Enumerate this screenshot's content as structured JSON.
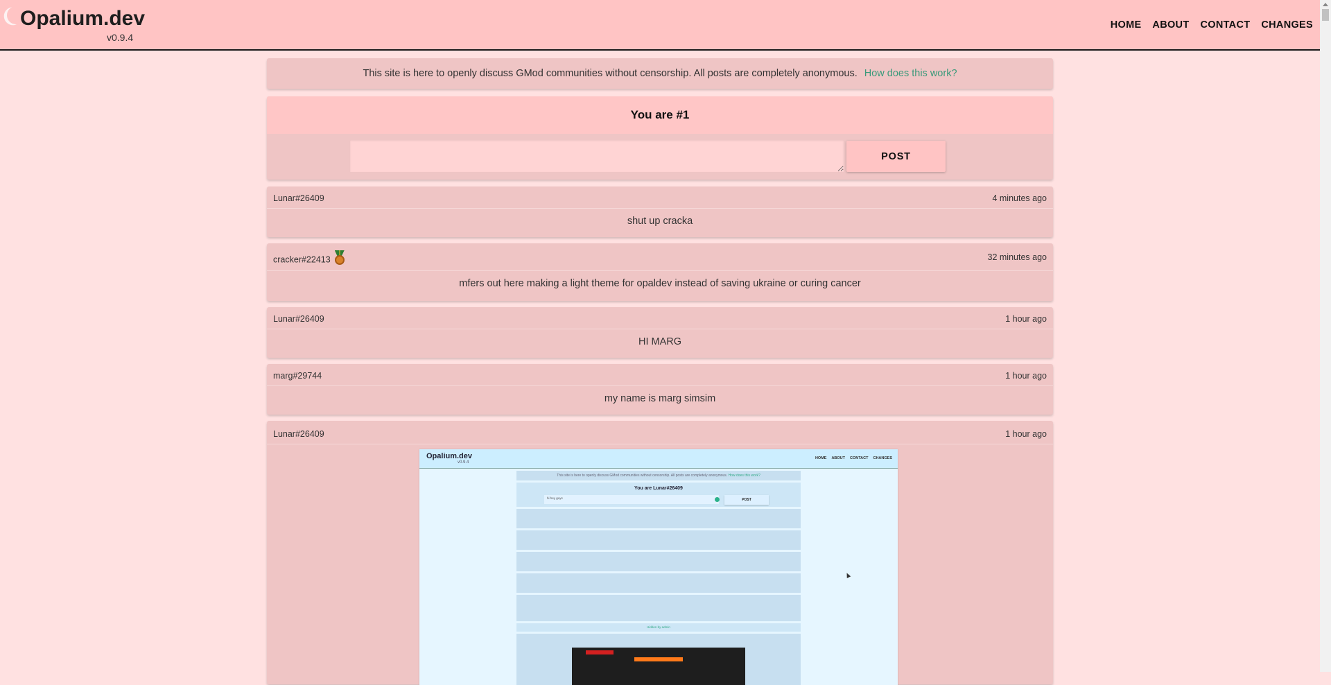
{
  "header": {
    "title": "Opalium.dev",
    "version": "v0.9.4",
    "nav": [
      "HOME",
      "ABOUT",
      "CONTACT",
      "CHANGES"
    ]
  },
  "notice": {
    "text": "This site is here to openly discuss GMod communities without censorship. All posts are completely anonymous.",
    "link": "How does this work?"
  },
  "composer": {
    "heading": "You are #1",
    "textarea_value": "",
    "post_label": "POST"
  },
  "posts": [
    {
      "author": "Lunar#26409",
      "time": "4 minutes ago",
      "body": "shut up cracka"
    },
    {
      "author": "cracker#22413",
      "time": "32 minutes ago",
      "body": "mfers out here making a light theme for opaldev instead of saving ukraine or curing cancer",
      "badge": "medal-icon"
    },
    {
      "author": "Lunar#26409",
      "time": "1 hour ago",
      "body": "HI MARG"
    },
    {
      "author": "marg#29744",
      "time": "1 hour ago",
      "body": "my name is marg simsim"
    },
    {
      "author": "Lunar#26409",
      "time": "1 hour ago",
      "body": ""
    }
  ],
  "embedded_screenshot": {
    "title": "Opalium.dev",
    "version": "v0.9.4",
    "nav": [
      "HOME",
      "ABOUT",
      "CONTACT",
      "CHANGES"
    ],
    "notice": "This site is here to openly discuss GMod communities without censorship. All posts are completely anonymous.",
    "notice_link": "How does this work?",
    "heading": "You are Lunar#26409",
    "input_value": "hi hey guys",
    "post_label": "POST",
    "load_more": "Hidden by admin"
  },
  "colors": {
    "background": "#ffe1e1",
    "header": "#ffc4c4",
    "card": "#efc5c5",
    "link": "#3a9a7a"
  }
}
